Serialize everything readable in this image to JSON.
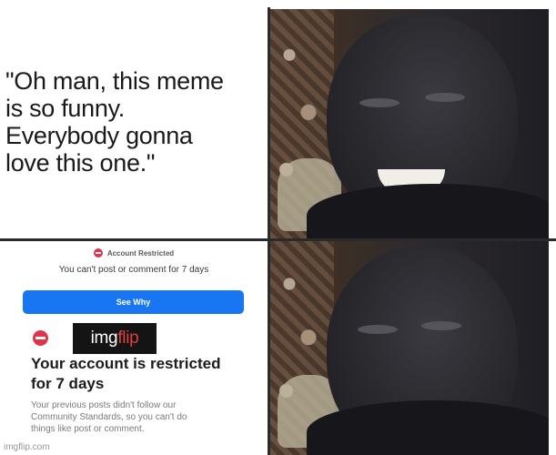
{
  "caption": {
    "text": "\"Oh man, this meme\nis so funny.\n Everybody gonna\nlove this one.\""
  },
  "notice": {
    "alert_title": "Account Restricted",
    "alert_subtitle": "You can't post or comment for 7 days",
    "button_label": "See Why",
    "headline": "Your account is restricted\nfor 7 days",
    "body": "Your previous posts didn't follow our\nCommunity Standards, so you can't do\nthings like post or comment.",
    "accent_color": "#1876f2",
    "alert_color": "#e0344a"
  },
  "watermark": {
    "part_a": "img",
    "part_b": "flip"
  },
  "footer": {
    "credit": "imgflip.com"
  },
  "photos": {
    "top_icon": "smiling-face",
    "bottom_icon": "disappointed-face"
  }
}
